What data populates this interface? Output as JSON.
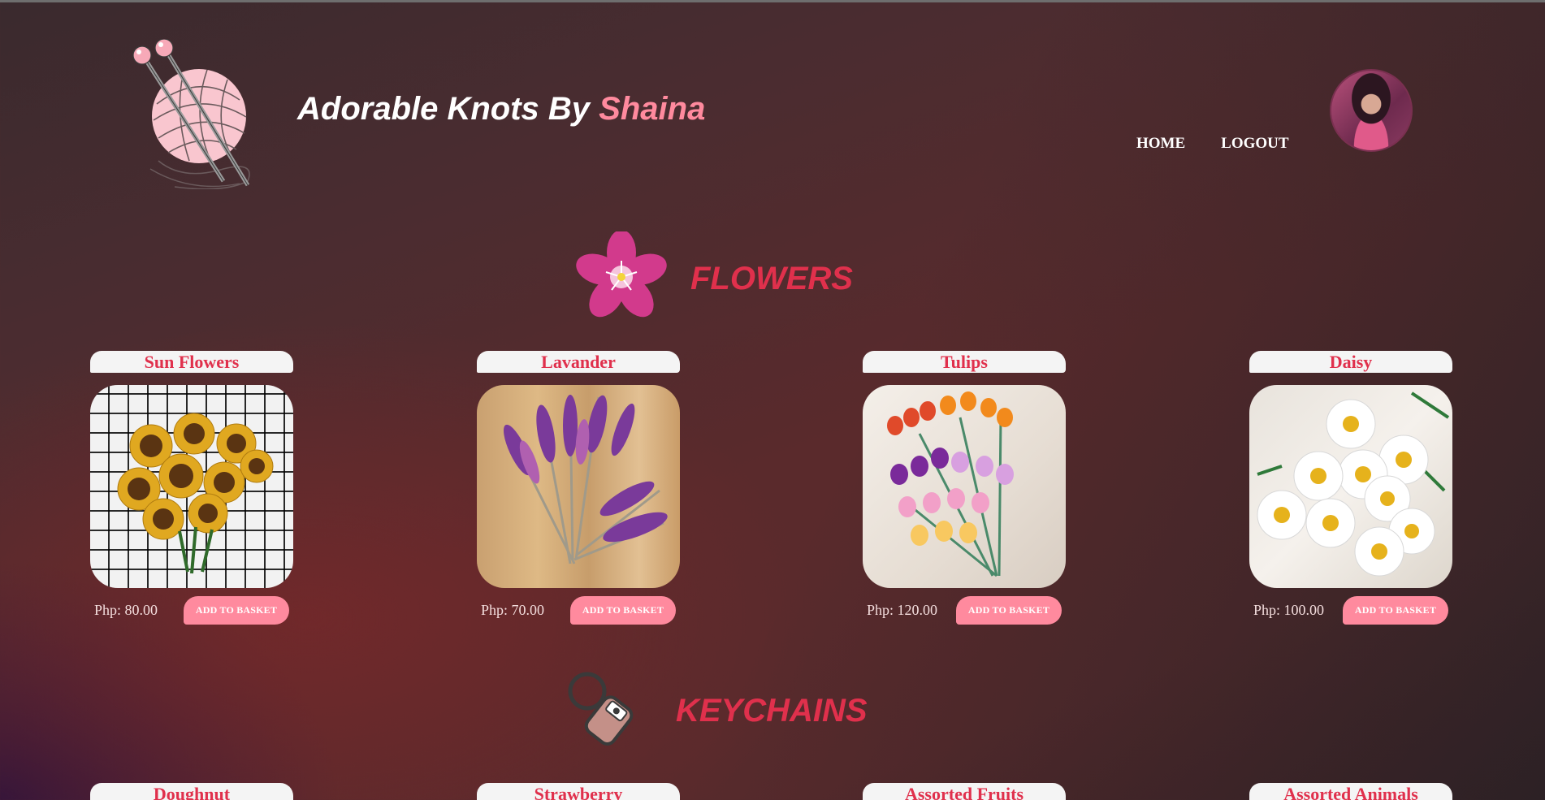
{
  "header": {
    "brand_prefix": "Adorable Knots By ",
    "brand_accent": "Shaina",
    "logo_icon": "yarn-ball-with-needles-icon",
    "nav": [
      {
        "label": "HOME"
      },
      {
        "label": "LOGOUT"
      }
    ],
    "avatar_icon": "user-avatar"
  },
  "colors": {
    "accent_pink": "#ff8a9e",
    "title_red": "#e0304c",
    "name_bar": "#f4f4f4"
  },
  "sections": [
    {
      "title": "FLOWERS",
      "icon": "pink-flower-icon",
      "products": [
        {
          "name": "Sun Flowers",
          "price": "Php: 80.00",
          "button": "ADD TO BASKET"
        },
        {
          "name": "Lavander",
          "price": "Php: 70.00",
          "button": "ADD TO BASKET"
        },
        {
          "name": "Tulips",
          "price": "Php: 120.00",
          "button": "ADD TO BASKET"
        },
        {
          "name": "Daisy",
          "price": "Php: 100.00",
          "button": "ADD TO BASKET"
        }
      ]
    },
    {
      "title": "KEYCHAINS",
      "icon": "keychain-icon",
      "products": [
        {
          "name": "Doughnut"
        },
        {
          "name": "Strawberry"
        },
        {
          "name": "Assorted Fruits"
        },
        {
          "name": "Assorted Animals"
        }
      ]
    }
  ]
}
